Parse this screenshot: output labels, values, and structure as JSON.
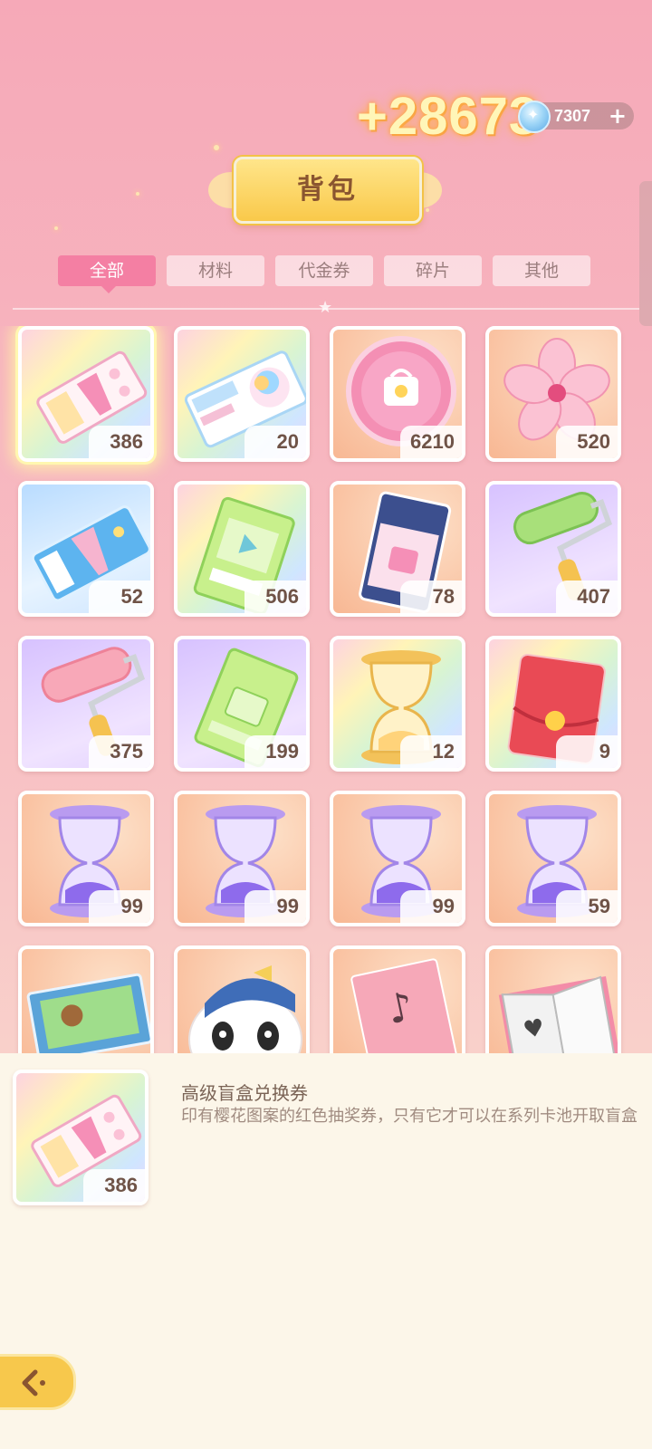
{
  "header": {
    "gain_text": "+28673",
    "currency_amount": "7307",
    "currency_plus": "+",
    "title": "背包"
  },
  "tabs": [
    {
      "label": "全部",
      "active": true
    },
    {
      "label": "材料",
      "active": false
    },
    {
      "label": "代金券",
      "active": false
    },
    {
      "label": "碎片",
      "active": false
    },
    {
      "label": "其他",
      "active": false
    }
  ],
  "items": [
    {
      "icon": "premium-blind-box-ticket-icon",
      "count": "386"
    },
    {
      "icon": "sakura-ticket-icon",
      "count": "20"
    },
    {
      "icon": "pink-coin-icon",
      "count": "6210"
    },
    {
      "icon": "sakura-flower-icon",
      "count": "520"
    },
    {
      "icon": "blue-ticket-icon",
      "count": "52"
    },
    {
      "icon": "video-ticket-icon",
      "count": "506"
    },
    {
      "icon": "navy-ticket-icon",
      "count": "78"
    },
    {
      "icon": "green-paint-roller-icon",
      "count": "407"
    },
    {
      "icon": "pink-paint-roller-icon",
      "count": "375"
    },
    {
      "icon": "green-ticket-icon",
      "count": "199"
    },
    {
      "icon": "golden-hourglass-icon",
      "count": "12"
    },
    {
      "icon": "red-envelope-icon",
      "count": "9"
    },
    {
      "icon": "purple-hourglass-icon",
      "count": "99"
    },
    {
      "icon": "purple-hourglass-icon",
      "count": "99"
    },
    {
      "icon": "purple-hourglass-icon",
      "count": "99"
    },
    {
      "icon": "purple-hourglass-icon",
      "count": "59"
    },
    {
      "icon": "jigsaw-puzzle-box-icon",
      "count": ""
    },
    {
      "icon": "panda-pillow-icon",
      "count": ""
    },
    {
      "icon": "music-book-icon",
      "count": ""
    },
    {
      "icon": "open-book-icon",
      "count": ""
    }
  ],
  "detail": {
    "name": "高级盲盒兑换券",
    "description": "印有樱花图案的红色抽奖券，只有它才可以在系列卡池开取盲盒",
    "count": "386"
  },
  "back_button": {
    "icon": "back-arrow-icon"
  },
  "colors": {
    "accent_pink": "#f47fa3",
    "gold": "#f9c94a"
  }
}
